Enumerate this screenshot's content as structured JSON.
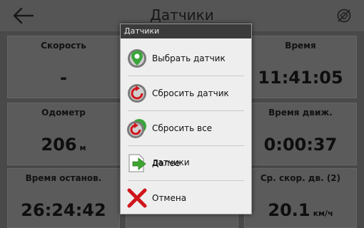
{
  "header": {
    "title": "Датчики"
  },
  "tiles": [
    {
      "label": "Скорость",
      "value": "-",
      "unit": ""
    },
    {
      "label": "",
      "value": "",
      "unit": ""
    },
    {
      "label": "Время",
      "value": "11:41:05",
      "unit": ""
    },
    {
      "label": "Одометр",
      "value": "206",
      "unit": "м"
    },
    {
      "label": "",
      "value": "",
      "unit": ""
    },
    {
      "label": "Время движ.",
      "value": "0:00:37",
      "unit": ""
    },
    {
      "label": "Время останов.",
      "value": "26:24:42",
      "unit": ""
    },
    {
      "label": "",
      "value": "",
      "unit": ""
    },
    {
      "label": "Ср. скор. дв. (2)",
      "value": "20.1",
      "unit": "км/ч"
    }
  ],
  "dialog": {
    "title": "Датчики",
    "items": [
      {
        "label": "Выбрать датчик",
        "icon": "select-sensor-icon"
      },
      {
        "label": "Сбросить датчик",
        "icon": "reset-sensor-icon"
      },
      {
        "label": "Сбросить все датчики",
        "icon": "reset-all-sensors-icon"
      },
      {
        "label": "Далее",
        "icon": "next-arrow-icon"
      },
      {
        "label": "Отмена",
        "icon": "cancel-x-icon"
      }
    ]
  },
  "colors": {
    "background": "#595959",
    "tile": "#6f6f6f",
    "dialog_header": "#3b3b3b",
    "dialog_body": "#eeeeee",
    "cancel_red": "#d0141b",
    "next_green": "#3fa62f"
  }
}
